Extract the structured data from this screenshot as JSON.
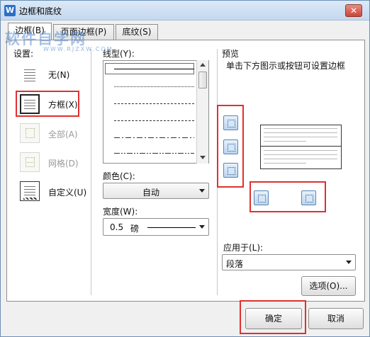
{
  "window": {
    "title": "边框和底纹",
    "app_icon_letter": "W",
    "close_symbol": "✕"
  },
  "watermark": {
    "main": "软件自学网",
    "sub": "WWW.RJZXW.COM"
  },
  "tabs": [
    {
      "label": "边框(B)",
      "active": true
    },
    {
      "label": "页面边框(P)",
      "active": false
    },
    {
      "label": "底纹(S)",
      "active": false
    }
  ],
  "settings": {
    "label": "设置:",
    "items": [
      {
        "label": "无(N)",
        "icon": "border-none-icon",
        "enabled": true
      },
      {
        "label": "方框(X)",
        "icon": "border-box-icon",
        "enabled": true,
        "selected": true
      },
      {
        "label": "全部(A)",
        "icon": "border-all-icon",
        "enabled": false
      },
      {
        "label": "网格(D)",
        "icon": "border-grid-icon",
        "enabled": false
      },
      {
        "label": "自定义(U)",
        "icon": "border-custom-icon",
        "enabled": true
      }
    ]
  },
  "line_style": {
    "label": "线型(Y):"
  },
  "color": {
    "label": "颜色(C):",
    "value": "自动"
  },
  "width": {
    "label": "宽度(W):",
    "value": "0.5",
    "unit": "磅"
  },
  "preview": {
    "label": "预览",
    "hint": "单击下方图示或按钮可设置边框",
    "buttons": [
      "top-border-button",
      "middle-border-button",
      "bottom-border-button",
      "left-border-button",
      "right-border-button"
    ]
  },
  "apply_to": {
    "label": "应用于(L):",
    "value": "段落"
  },
  "buttons": {
    "options": "选项(O)...",
    "ok": "确定",
    "cancel": "取消"
  },
  "colors": {
    "highlight": "#e03030",
    "title_bar": "#c5d8ee",
    "accent": "#2c6fc8"
  }
}
